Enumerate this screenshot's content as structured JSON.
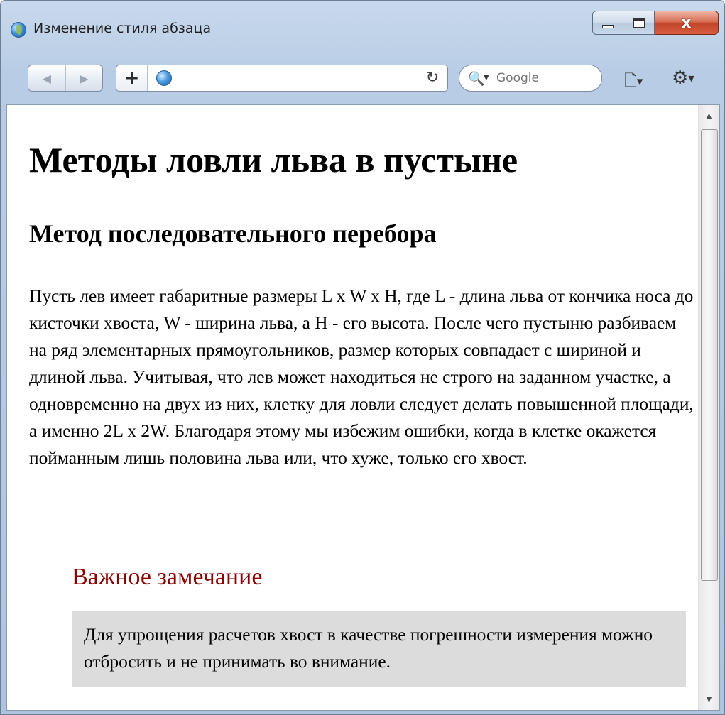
{
  "window": {
    "title": "Изменение стиля абзаца",
    "controls": {
      "minimize": "",
      "maximize": "",
      "close": "x"
    }
  },
  "toolbar": {
    "back_icon": "◀",
    "forward_icon": "▶",
    "add_icon": "+",
    "address_value": "",
    "reload_icon": "↻",
    "search_placeholder": "Google",
    "search_icon": "🔍",
    "page_menu_icon": "🗋",
    "gear_icon": "⚙"
  },
  "page": {
    "h1": "Методы ловли льва в пустыне",
    "h2": "Метод последовательного перебора",
    "paragraph": "Пусть лев имеет габаритные размеры L x W x H, где L - длина льва от кончика носа до кисточки хвоста, W - ширина льва, а H - его высота. После чего пустыню разбиваем на ряд элементарных прямоугольников, размер которых совпадает с шириной и длиной льва. Учитывая, что лев может находиться не строго на заданном участке, а одновременно на двух из них, клетку для ловли следует делать повышенной площади, а именно 2L x 2W. Благодаря этому мы избежим ошибки, когда в клетке окажется пойманным лишь половина льва или, что хуже, только его хвост.",
    "note_title": "Важное замечание",
    "note_text": "Для упрощения расчетов хвост в качестве погрешности измерения можно отбросить и не принимать во внимание."
  },
  "colors": {
    "note_title": "#8b0000",
    "note_background": "#dcdcdc"
  }
}
